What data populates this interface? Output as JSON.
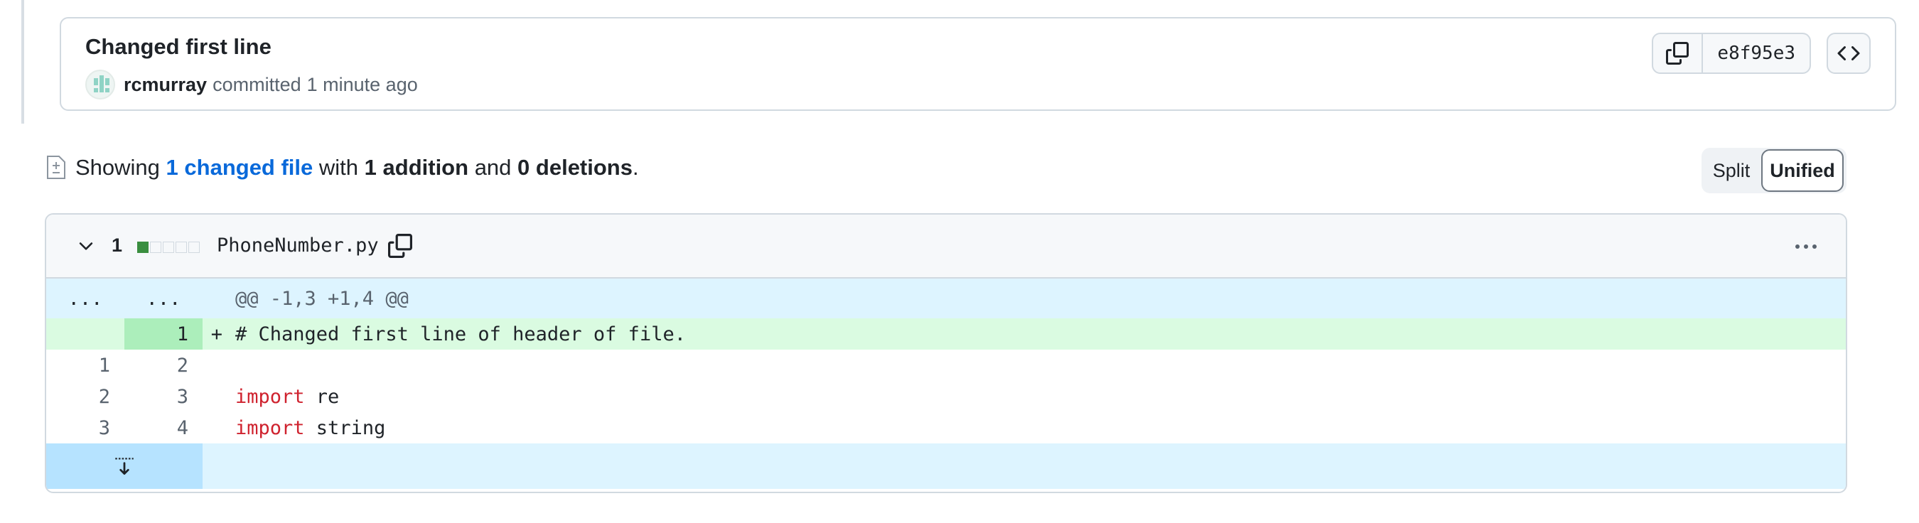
{
  "commit": {
    "title": "Changed first line",
    "author": "rcmurray",
    "action": "committed",
    "time": "1 minute ago",
    "sha": "e8f95e3"
  },
  "summary": {
    "prefix": "Showing",
    "changed_files": "1 changed file",
    "with": "with",
    "additions": "1 addition",
    "and": "and",
    "deletions": "0 deletions",
    "period": "."
  },
  "view_toggle": {
    "split": "Split",
    "unified": "Unified",
    "selected": "Unified"
  },
  "file": {
    "change_count": "1",
    "name": "PhoneNumber.py",
    "diffstat": [
      "add",
      "neutral",
      "neutral",
      "neutral",
      "neutral"
    ]
  },
  "diff": {
    "hunk_header": "@@ -1,3 +1,4 @@",
    "hunk_old": "...",
    "hunk_new": "...",
    "lines": [
      {
        "old": "",
        "new": "1",
        "sign": "+",
        "type": "addition",
        "keyword": "",
        "text": "# Changed first line of header of file."
      },
      {
        "old": "1",
        "new": "2",
        "sign": "",
        "type": "context",
        "keyword": "",
        "text": ""
      },
      {
        "old": "2",
        "new": "3",
        "sign": "",
        "type": "context",
        "keyword": "import",
        "text": " re"
      },
      {
        "old": "3",
        "new": "4",
        "sign": "",
        "type": "context",
        "keyword": "import",
        "text": " string"
      }
    ]
  },
  "colors": {
    "addition_bg": "#dafbe1",
    "addition_num_bg": "#aceebb",
    "hunk_bg": "#ddf4ff",
    "expander_bg": "#b6e3ff",
    "link": "#0969da",
    "keyword": "#cf222e",
    "diffstat_add": "#3a8e3f"
  }
}
